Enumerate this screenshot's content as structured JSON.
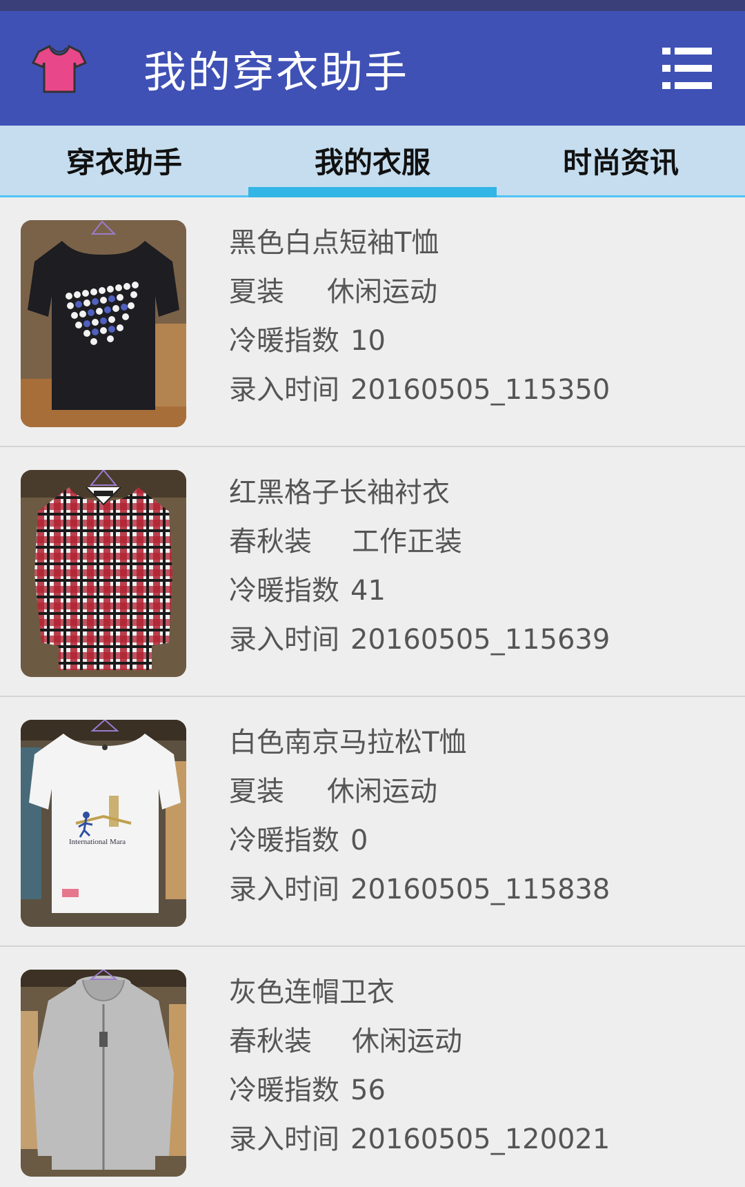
{
  "app_bar": {
    "title": "我的穿衣助手",
    "logo_icon": "tshirt-icon",
    "menu_icon": "list-menu-icon"
  },
  "tabs": [
    {
      "label": "穿衣助手",
      "active": false
    },
    {
      "label": "我的衣服",
      "active": true
    },
    {
      "label": "时尚资讯",
      "active": false
    }
  ],
  "labels": {
    "warmth": "冷暖指数",
    "entry_time": "录入时间"
  },
  "items": [
    {
      "name": "黑色白点短袖T恤",
      "season": "夏装",
      "style": "休闲运动",
      "warmth": "10",
      "time": "20160505_115350",
      "image": "black-tshirt-with-white-dots"
    },
    {
      "name": "红黑格子长袖衬衣",
      "season": "春秋装",
      "style": "工作正装",
      "warmth": "41",
      "time": "20160505_115639",
      "image": "red-black-plaid-shirt"
    },
    {
      "name": "白色南京马拉松T恤",
      "season": "夏装",
      "style": "休闲运动",
      "warmth": "0",
      "time": "20160505_115838",
      "image": "white-marathon-tshirt"
    },
    {
      "name": "灰色连帽卫衣",
      "season": "春秋装",
      "style": "休闲运动",
      "warmth": "56",
      "time": "20160505_120021",
      "image": "gray-hoodie"
    }
  ],
  "colors": {
    "app_bar": "#3f51b5",
    "tab_bar": "#c5ddee",
    "tab_indicator": "#33b5e5",
    "background": "#eeeeee",
    "text_secondary": "#555555"
  }
}
